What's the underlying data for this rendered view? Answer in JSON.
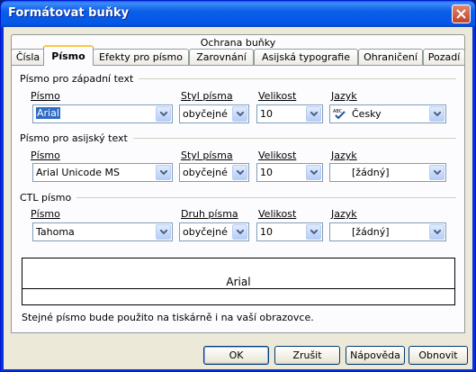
{
  "window": {
    "title": "Formátovat buňky"
  },
  "tabs": {
    "top_row": "Ochrana buňky",
    "items": [
      "Čísla",
      "Písmo",
      "Efekty pro písmo",
      "Zarovnání",
      "Asijská typografie",
      "Ohraničení",
      "Pozadí"
    ],
    "active": "Písmo"
  },
  "western": {
    "heading": "Písmo pro západní text",
    "font_label": "Písmo",
    "style_label": "Styl písma",
    "size_label": "Velikost",
    "lang_label": "Jazyk",
    "font_value": "Arial",
    "style_value": "obyčejné",
    "size_value": "10",
    "lang_value": "Česky",
    "lang_icon": "spellcheck-abc-icon"
  },
  "asian": {
    "heading": "Písmo pro asijský text",
    "font_label": "Písmo",
    "style_label": "Styl písma",
    "size_label": "Velikost",
    "lang_label": "Jazyk",
    "font_value": "Arial Unicode MS",
    "style_value": "obyčejné",
    "size_value": "10",
    "lang_value": "[žádný]"
  },
  "ctl": {
    "heading": "CTL písmo",
    "font_label": "Písmo",
    "style_label": "Druh písma",
    "size_label": "Velikost",
    "lang_label": "Jazyk",
    "font_value": "Tahoma",
    "style_value": "obyčejné",
    "size_value": "10",
    "lang_value": "[žádný]"
  },
  "preview": {
    "text": "Arial"
  },
  "note": "Stejné písmo bude použito na tiskárně i na vaší obrazovce.",
  "buttons": {
    "ok": "OK",
    "cancel": "Zrušit",
    "help": "Nápověda",
    "reset": "Obnovit"
  },
  "colors": {
    "titlebar": "#0a5ee8",
    "face": "#ece9d8",
    "panel": "#fcfcfe",
    "active_tab_accent": "#ffc83c",
    "selection": "#316ac5"
  }
}
